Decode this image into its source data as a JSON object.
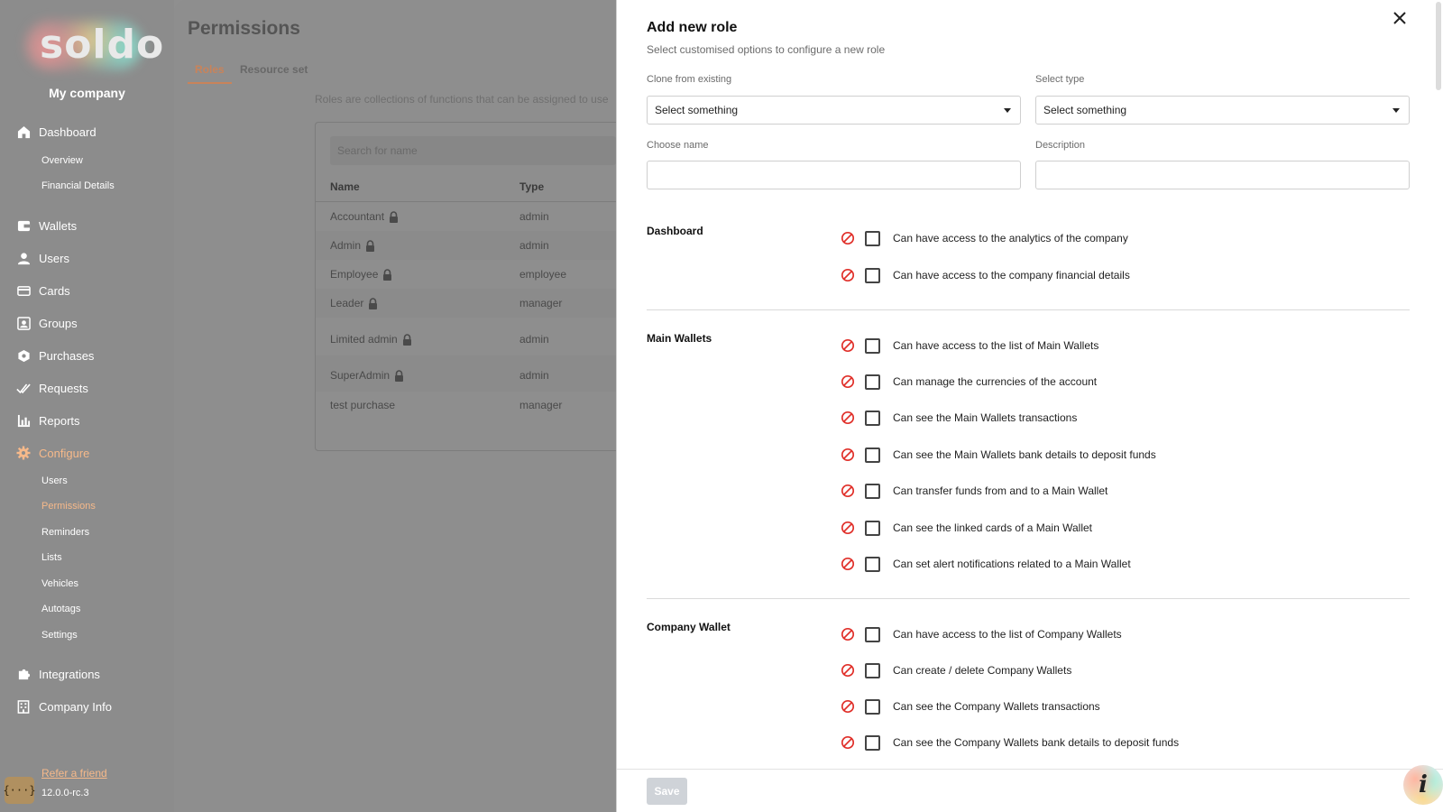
{
  "sidebar": {
    "logo": "soldo",
    "company": "My company",
    "nav": {
      "dashboard": "Dashboard",
      "overview": "Overview",
      "financial_details": "Financial Details",
      "wallets": "Wallets",
      "users": "Users",
      "cards": "Cards",
      "groups": "Groups",
      "purchases": "Purchases",
      "requests": "Requests",
      "reports": "Reports",
      "configure": "Configure",
      "cfg_users": "Users",
      "cfg_permissions": "Permissions",
      "cfg_reminders": "Reminders",
      "cfg_lists": "Lists",
      "cfg_vehicles": "Vehicles",
      "cfg_autotags": "Autotags",
      "cfg_settings": "Settings",
      "integrations": "Integrations",
      "company_info": "Company Info"
    },
    "refer": "Refer a friend",
    "version": "12.0.0-rc.3",
    "code_badge": "{···}",
    "accent_color": "#f6b98a"
  },
  "main": {
    "title": "Permissions",
    "tabs": [
      "Roles",
      "Resource set"
    ],
    "description": "Roles are collections of functions that can be assigned to use",
    "search_placeholder": "Search for name",
    "columns": [
      "Name",
      "Type"
    ],
    "rows": [
      {
        "name": "Accountant",
        "type": "admin",
        "locked": true
      },
      {
        "name": "Admin",
        "type": "admin",
        "locked": true
      },
      {
        "name": "Employee",
        "type": "employee",
        "locked": true
      },
      {
        "name": "Leader",
        "type": "manager",
        "locked": true
      },
      {
        "name": "Limited admin",
        "type": "admin",
        "locked": true
      },
      {
        "name": "SuperAdmin",
        "type": "admin",
        "locked": true
      },
      {
        "name": "test purchase",
        "type": "manager",
        "locked": false
      }
    ]
  },
  "panel": {
    "title": "Add new role",
    "subtitle": "Select customised options to configure a new role",
    "clone_label": "Clone from existing",
    "clone_value": "Select something",
    "type_label": "Select type",
    "type_value": "Select something",
    "name_label": "Choose name",
    "name_value": "",
    "description_label": "Description",
    "description_value": "",
    "sections": {
      "dashboard": {
        "title": "Dashboard",
        "items": [
          "Can have access to the analytics of the company",
          "Can have access to the company financial details"
        ]
      },
      "main_wallets": {
        "title": "Main Wallets",
        "items": [
          "Can have access to the list of Main Wallets",
          "Can manage the currencies of the account",
          "Can see the Main Wallets transactions",
          "Can see the Main Wallets bank details to deposit funds",
          "Can transfer funds from and to a Main Wallet",
          "Can see the linked cards of a Main Wallet",
          "Can set alert notifications related to a Main Wallet"
        ]
      },
      "company_wallet": {
        "title": "Company Wallet",
        "items": [
          "Can have access to the list of Company Wallets",
          "Can create / delete Company Wallets",
          "Can see the Company Wallets transactions",
          "Can see the Company Wallets bank details to deposit funds"
        ]
      }
    },
    "save_label": "Save",
    "deny_color": "#e0302a"
  },
  "info_button": "i"
}
